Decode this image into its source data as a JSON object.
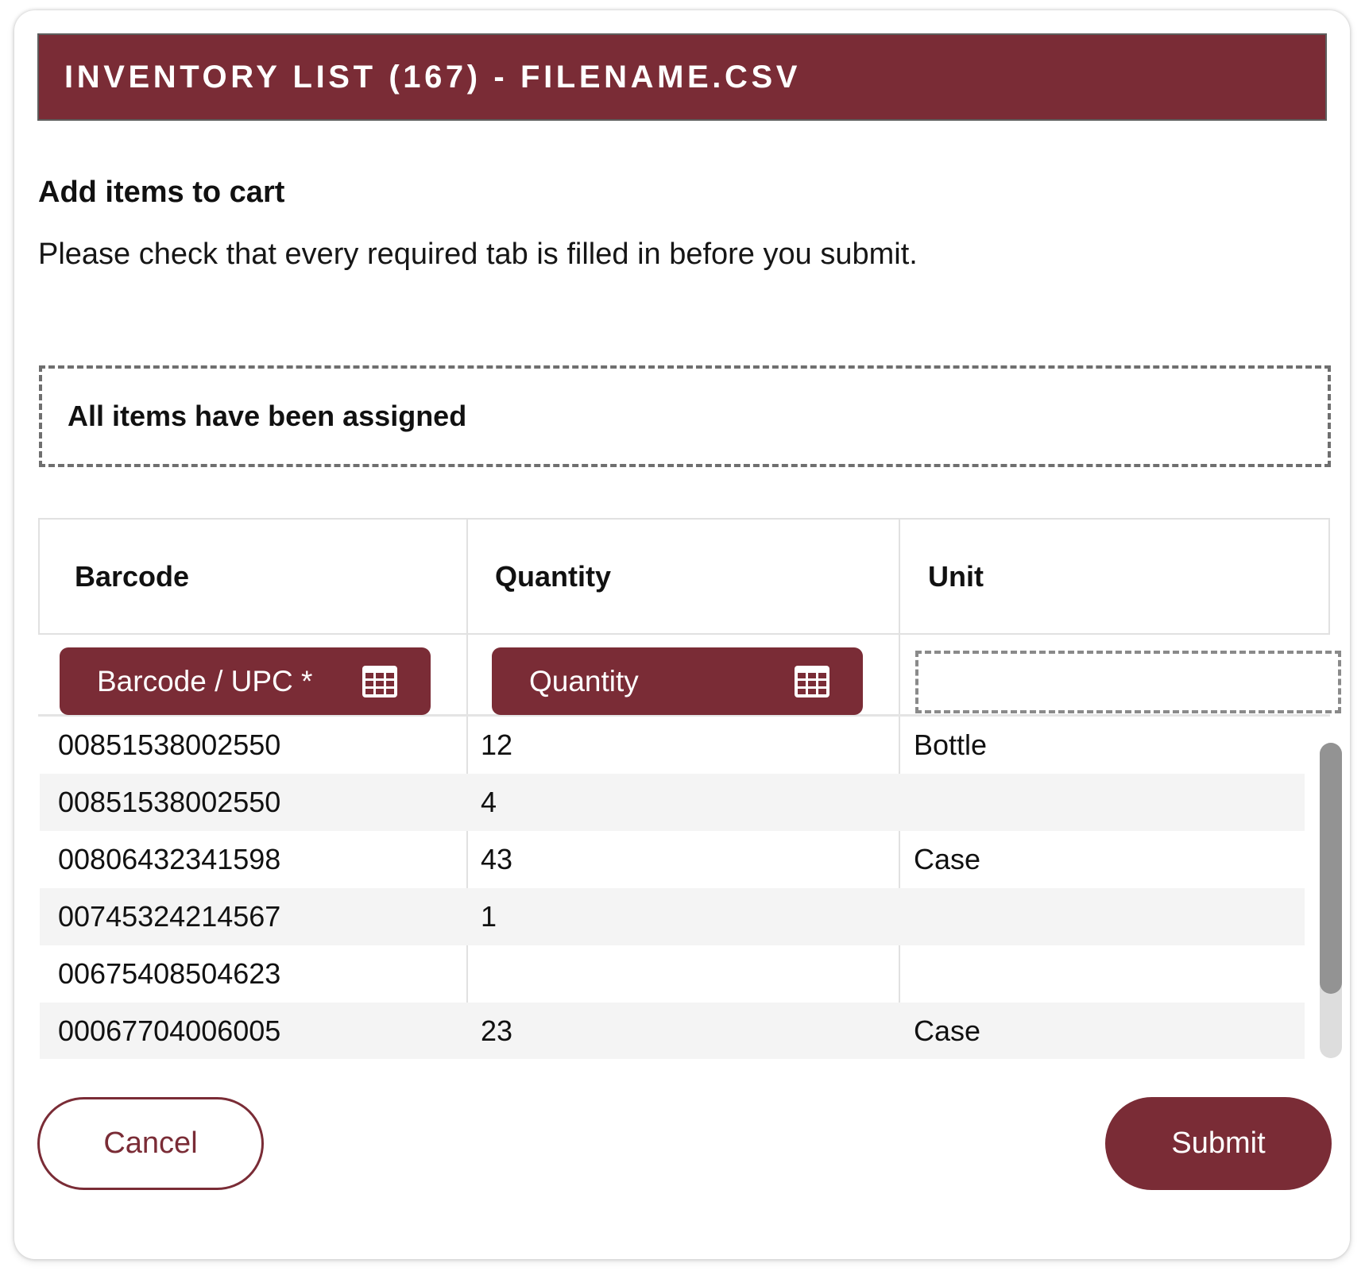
{
  "colors": {
    "accent": "#7a2c36",
    "border": "#e1e1e1",
    "row_alt": "#f4f4f4",
    "dashed": "#6f6f6f"
  },
  "dialog": {
    "title": "INVENTORY LIST (167) - FILENAME.CSV",
    "subtitle": "Add items to cart",
    "instructions": "Please check that every required tab is filled in before you submit.",
    "status": "All items have been assigned"
  },
  "table": {
    "columns": [
      "Barcode",
      "Quantity",
      "Unit"
    ],
    "mappings": [
      {
        "label": "Barcode / UPC *",
        "icon": "grid-icon"
      },
      {
        "label": "Quantity",
        "icon": "grid-icon"
      },
      {
        "label": ""
      }
    ],
    "rows": [
      [
        "00851538002550",
        "12",
        "Bottle"
      ],
      [
        "00851538002550",
        "4",
        ""
      ],
      [
        "00806432341598",
        "43",
        "Case"
      ],
      [
        "00745324214567",
        "1",
        ""
      ],
      [
        "00675408504623",
        "",
        ""
      ],
      [
        "00067704006005",
        "23",
        "Case"
      ]
    ]
  },
  "actions": {
    "cancel": "Cancel",
    "submit": "Submit"
  }
}
